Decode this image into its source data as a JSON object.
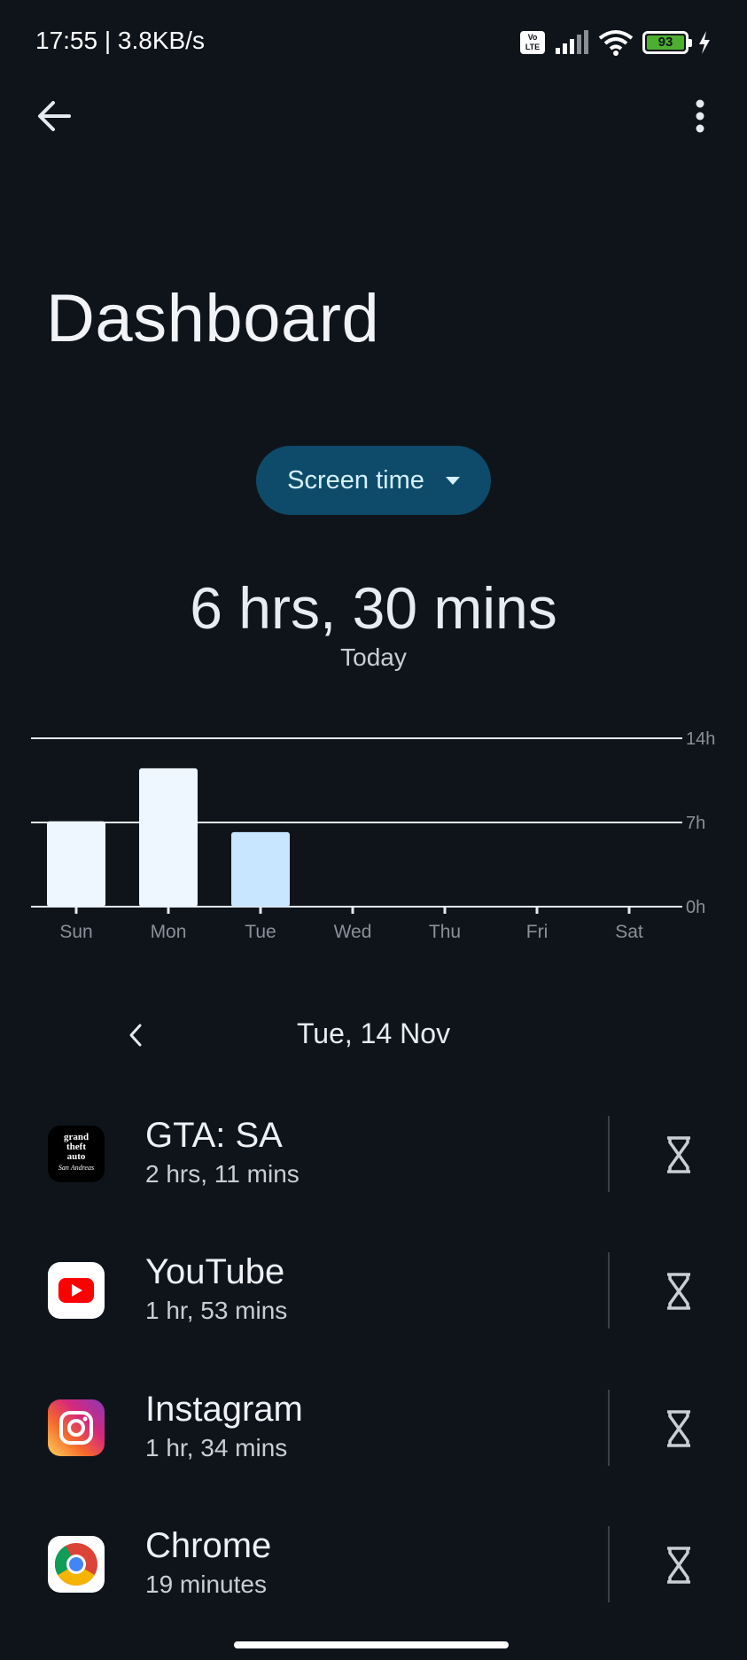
{
  "status_bar": {
    "time_speed": "17:55 | 3.8KB/s",
    "volte": "Vo\nLTE",
    "battery_level": "93",
    "battery_percent": 93
  },
  "header": {
    "title": "Dashboard",
    "back_icon": "arrow-left-icon",
    "more_icon": "more-vert-icon"
  },
  "metric_selector": {
    "label": "Screen time",
    "icon": "caret-down-icon"
  },
  "summary": {
    "total": "6 hrs, 30 mins",
    "period": "Today"
  },
  "chart_data": {
    "type": "bar",
    "categories": [
      "Sun",
      "Mon",
      "Tue",
      "Wed",
      "Thu",
      "Fri",
      "Sat"
    ],
    "values": [
      7.1,
      11.5,
      6.2,
      0,
      0,
      0,
      0
    ],
    "y_ticks": [
      "0h",
      "7h",
      "14h"
    ],
    "ylim": [
      0,
      14
    ],
    "grid": true,
    "selected_category": "Tue",
    "colors": {
      "bar": "#eef6ff",
      "selected_bar": "#c8e6ff",
      "grid": "#e6e9ee",
      "tick_label": "#8a9099"
    }
  },
  "date_nav": {
    "label": "Tue, 14 Nov",
    "prev_icon": "chevron-left-icon"
  },
  "apps": [
    {
      "name": "GTA: SA",
      "time": "2 hrs, 11 mins",
      "icon": "gta-sa-icon",
      "icon_text": "grand theft auto San Andreas"
    },
    {
      "name": "YouTube",
      "time": "1 hr, 53 mins",
      "icon": "youtube-icon"
    },
    {
      "name": "Instagram",
      "time": "1 hr, 34 mins",
      "icon": "instagram-icon"
    },
    {
      "name": "Chrome",
      "time": "19 minutes",
      "icon": "chrome-icon"
    }
  ],
  "timer_icon": "hourglass-icon"
}
